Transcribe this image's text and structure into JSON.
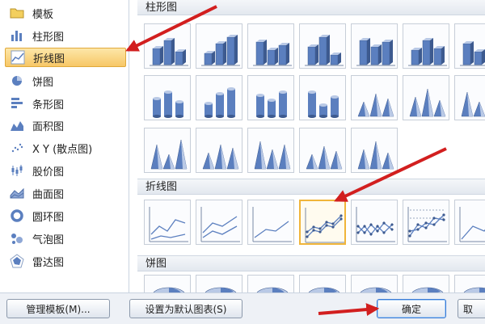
{
  "chart_types": [
    {
      "label": "模板",
      "icon": "folder-icon",
      "selected": false
    },
    {
      "label": "柱形图",
      "icon": "column-chart-icon",
      "selected": false
    },
    {
      "label": "折线图",
      "icon": "line-chart-icon",
      "selected": true
    },
    {
      "label": "饼图",
      "icon": "pie-chart-icon",
      "selected": false
    },
    {
      "label": "条形图",
      "icon": "bar-chart-icon",
      "selected": false
    },
    {
      "label": "面积图",
      "icon": "area-chart-icon",
      "selected": false
    },
    {
      "label": "X Y (散点图)",
      "icon": "scatter-chart-icon",
      "selected": false
    },
    {
      "label": "股价图",
      "icon": "stock-chart-icon",
      "selected": false
    },
    {
      "label": "曲面图",
      "icon": "surface-chart-icon",
      "selected": false
    },
    {
      "label": "圆环图",
      "icon": "doughnut-chart-icon",
      "selected": false
    },
    {
      "label": "气泡图",
      "icon": "bubble-chart-icon",
      "selected": false
    },
    {
      "label": "雷达图",
      "icon": "radar-chart-icon",
      "selected": false
    }
  ],
  "gallery": {
    "sections": [
      {
        "title": "柱形图"
      },
      {
        "title": "折线图"
      },
      {
        "title": "饼图"
      }
    ],
    "selected_line_subtype_index": 3
  },
  "buttons": {
    "manage_templates": "管理模板(M)...",
    "set_default": "设置为默认图表(S)",
    "ok": "确定",
    "cancel": "取"
  },
  "colors": {
    "selection_highlight": "#f7c766",
    "arrow": "#d21f1f",
    "chart_blue": "#5b7fbf"
  }
}
